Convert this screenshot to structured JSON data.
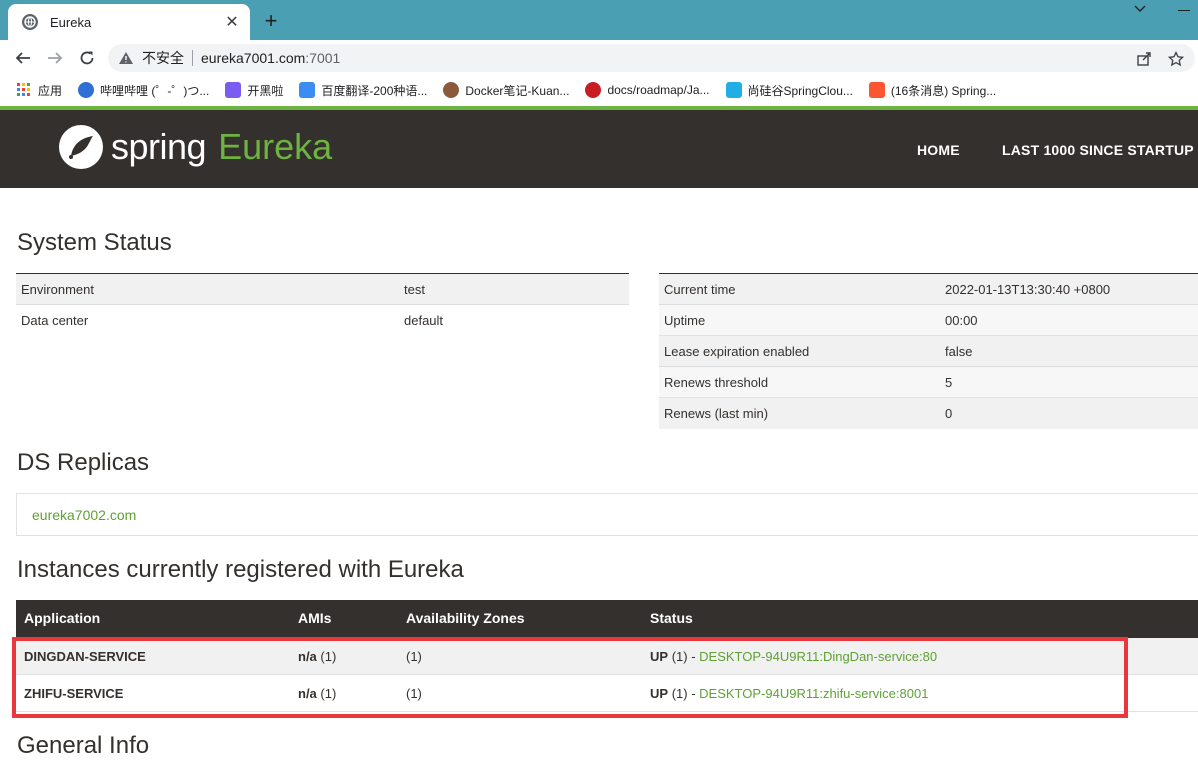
{
  "browser": {
    "tab_title": "Eureka",
    "tab_close": "✕",
    "new_tab": "+",
    "address": {
      "security_label": "不安全",
      "host": "eureka7001.com",
      "port": ":7001"
    },
    "bookmarks": [
      {
        "label": "应用",
        "icon": "apps-grid-icon",
        "color": "#ea4335"
      },
      {
        "label": "哔哩哔哩 (゜-゜)つ...",
        "icon": "bilibili-icon",
        "color": "#2f6fd6"
      },
      {
        "label": "开黑啦",
        "icon": "kaiheila-icon",
        "color": "#7b5cf0"
      },
      {
        "label": "百度翻译-200种语...",
        "icon": "baidu-translate-icon",
        "color": "#3c8cf3"
      },
      {
        "label": "Docker笔记-Kuan...",
        "icon": "avatar-icon",
        "color": "#8b5a3c"
      },
      {
        "label": "docs/roadmap/Ja...",
        "icon": "gitee-icon",
        "color": "#c71d23"
      },
      {
        "label": "尚硅谷SpringClou...",
        "icon": "bilibili-tv-icon",
        "color": "#23ade5"
      },
      {
        "label": "(16条消息) Spring...",
        "icon": "csdn-icon",
        "color": "#fc5531"
      }
    ]
  },
  "header": {
    "logo_spring": "spring",
    "logo_eureka": "Eureka",
    "nav": [
      "HOME",
      "LAST 1000 SINCE STARTUP"
    ]
  },
  "system_status": {
    "title": "System Status",
    "left": [
      {
        "key": "Environment",
        "value": "test"
      },
      {
        "key": "Data center",
        "value": "default"
      }
    ],
    "right": [
      {
        "key": "Current time",
        "value": "2022-01-13T13:30:40 +0800"
      },
      {
        "key": "Uptime",
        "value": "00:00"
      },
      {
        "key": "Lease expiration enabled",
        "value": "false"
      },
      {
        "key": "Renews threshold",
        "value": "5"
      },
      {
        "key": "Renews (last min)",
        "value": "0"
      }
    ]
  },
  "replicas": {
    "title": "DS Replicas",
    "items": [
      "eureka7002.com"
    ]
  },
  "instances": {
    "title": "Instances currently registered with Eureka",
    "columns": [
      "Application",
      "AMIs",
      "Availability Zones",
      "Status"
    ],
    "rows": [
      {
        "application": "DINGDAN-SERVICE",
        "amis_bold": "n/a",
        "amis_count": "(1)",
        "zones": "(1)",
        "status_bold": "UP",
        "status_count": "(1) -",
        "instance_link": "DESKTOP-94U9R11:DingDan-service:80"
      },
      {
        "application": "ZHIFU-SERVICE",
        "amis_bold": "n/a",
        "amis_count": "(1)",
        "zones": "(1)",
        "status_bold": "UP",
        "status_count": "(1) -",
        "instance_link": "DESKTOP-94U9R11:zhifu-service:8001"
      }
    ]
  },
  "general_info": {
    "title": "General Info"
  },
  "colors": {
    "brand_green": "#6db33f",
    "header_dark": "#34302d",
    "highlight_red": "#e8383d",
    "tabstrip": "#4a9fb2"
  }
}
